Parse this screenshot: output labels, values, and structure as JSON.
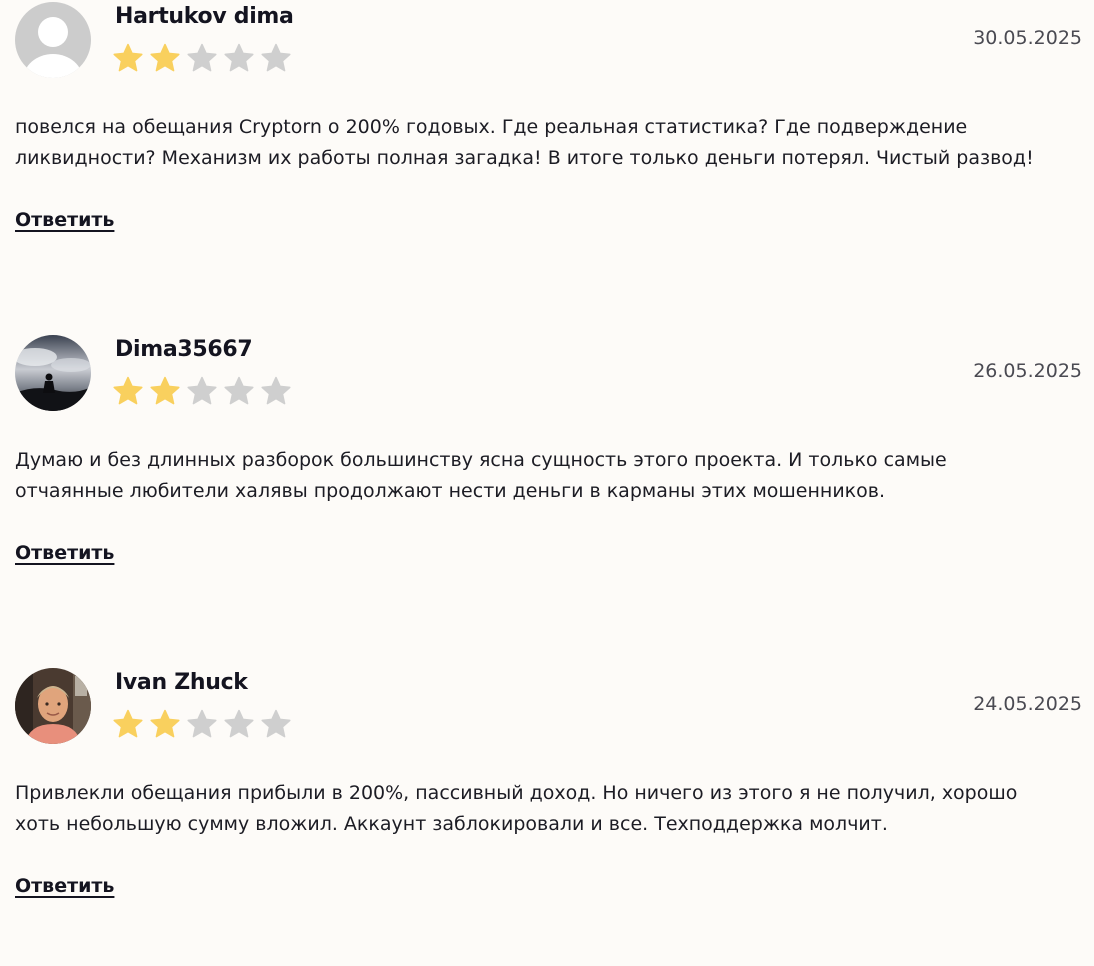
{
  "reply_label": "Ответить",
  "colors": {
    "star_filled": "#f9d05e",
    "star_empty": "#cfcfcf",
    "background": "#fdfbf8"
  },
  "reviews": [
    {
      "author": "Hartukov dima",
      "date": "30.05.2025",
      "rating": 2,
      "max_rating": 5,
      "avatar": "default-user-avatar",
      "lines": [
        "повелся на обещания Cryptorn о 200% годовых. Где реальная статистика? Где подверждение",
        "ликвидности? Механизм их работы полная загадка! В итоге только деньги потерял. Чистый развод!"
      ]
    },
    {
      "author": "Dima35667",
      "date": "26.05.2025",
      "rating": 2,
      "max_rating": 5,
      "avatar": "photo-silhouette-sky-avatar",
      "lines": [
        "Думаю и без длинных разборок большинству ясна сущность этого проекта. И только самые",
        "отчаянные любители халявы продолжают нести деньги в карманы этих мошенников."
      ]
    },
    {
      "author": "Ivan Zhuck",
      "date": "24.05.2025",
      "rating": 2,
      "max_rating": 5,
      "avatar": "photo-person-avatar",
      "lines": [
        "Привлекли обещания прибыли в 200%, пассивный доход. Но ничего из этого я не получил, хорошо",
        "хоть небольшую сумму вложил. Аккаунт заблокировали и все. Техподдержка молчит."
      ]
    }
  ]
}
